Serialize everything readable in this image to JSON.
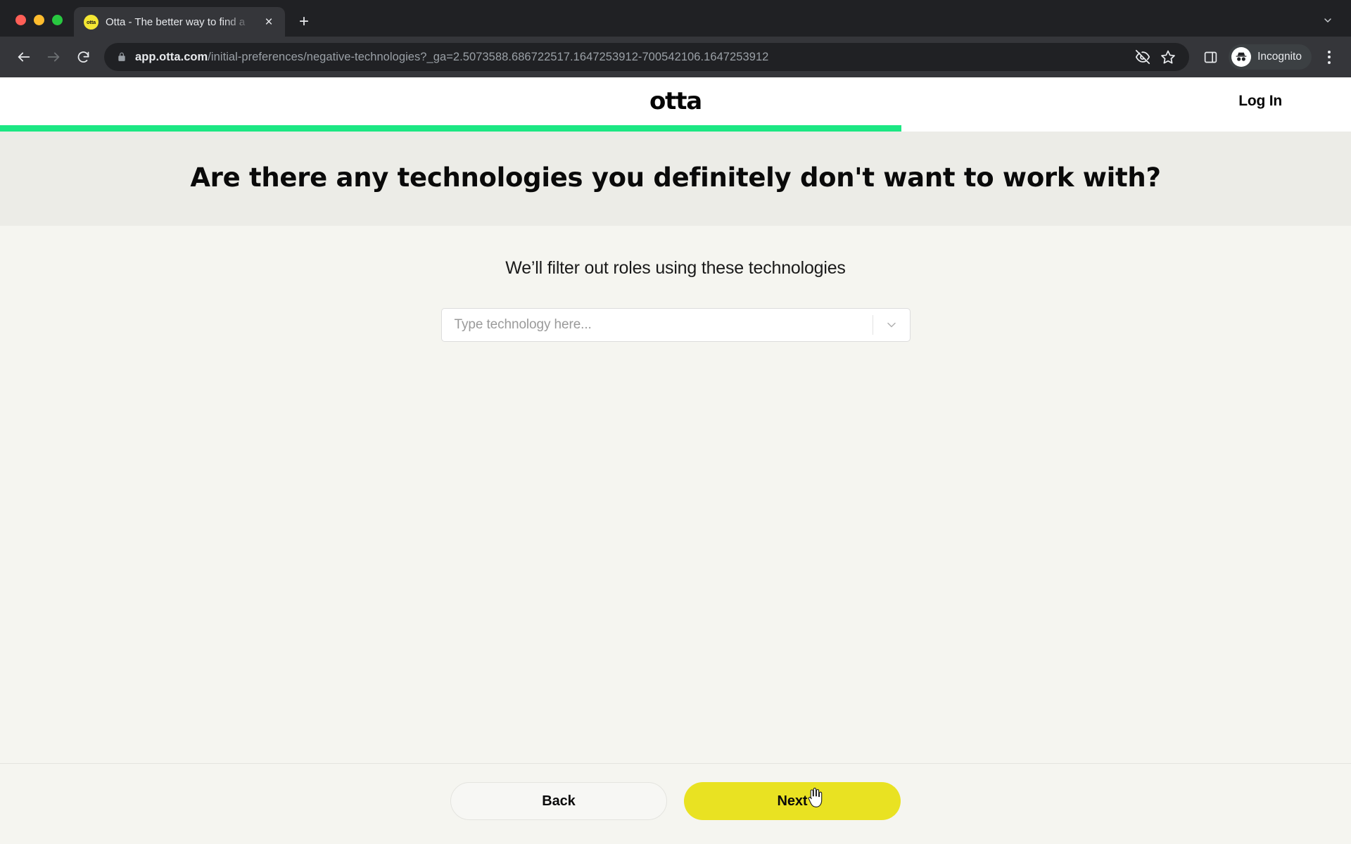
{
  "browser": {
    "tab": {
      "title": "Otta - The better way to find a",
      "favicon_text": "otta",
      "close_glyph": "×"
    },
    "newtab_glyph": "+",
    "toolbar": {
      "back_icon": "back-arrow-icon",
      "forward_icon": "forward-arrow-icon",
      "reload_icon": "reload-icon",
      "lock_icon": "lock-icon",
      "url_host": "app.otta.com",
      "url_path": "/initial-preferences/negative-technologies?_ga=2.5073588.686722517.1647253912-700542106.1647253912",
      "url_full": "app.otta.com/initial-preferences/negative-technologies?_ga=2.5073588.686722517.1647253912-700542106.1647253912",
      "tracking_protection_icon": "eye-off-icon",
      "bookmark_icon": "star-icon",
      "side_panel_icon": "side-panel-icon",
      "profile_label": "Incognito",
      "profile_icon": "incognito-hat-icon",
      "menu_icon": "three-dot-menu-icon"
    }
  },
  "page": {
    "logo": "otta",
    "login_label": "Log In",
    "progress_percent": 66.7,
    "heading": "Are there any technologies you definitely don't want to work with?",
    "subtitle": "We’ll filter out roles using these technologies",
    "select": {
      "placeholder": "Type technology here...",
      "value": "",
      "arrow_icon": "chevron-down-icon"
    },
    "footer": {
      "back_label": "Back",
      "next_label": "Next"
    },
    "colors": {
      "progress_green": "#1CE783",
      "next_yellow": "#E9E222",
      "hero_background": "#ECECE7",
      "body_background": "#F5F5F0",
      "favicon_yellow": "#F4E733"
    }
  }
}
